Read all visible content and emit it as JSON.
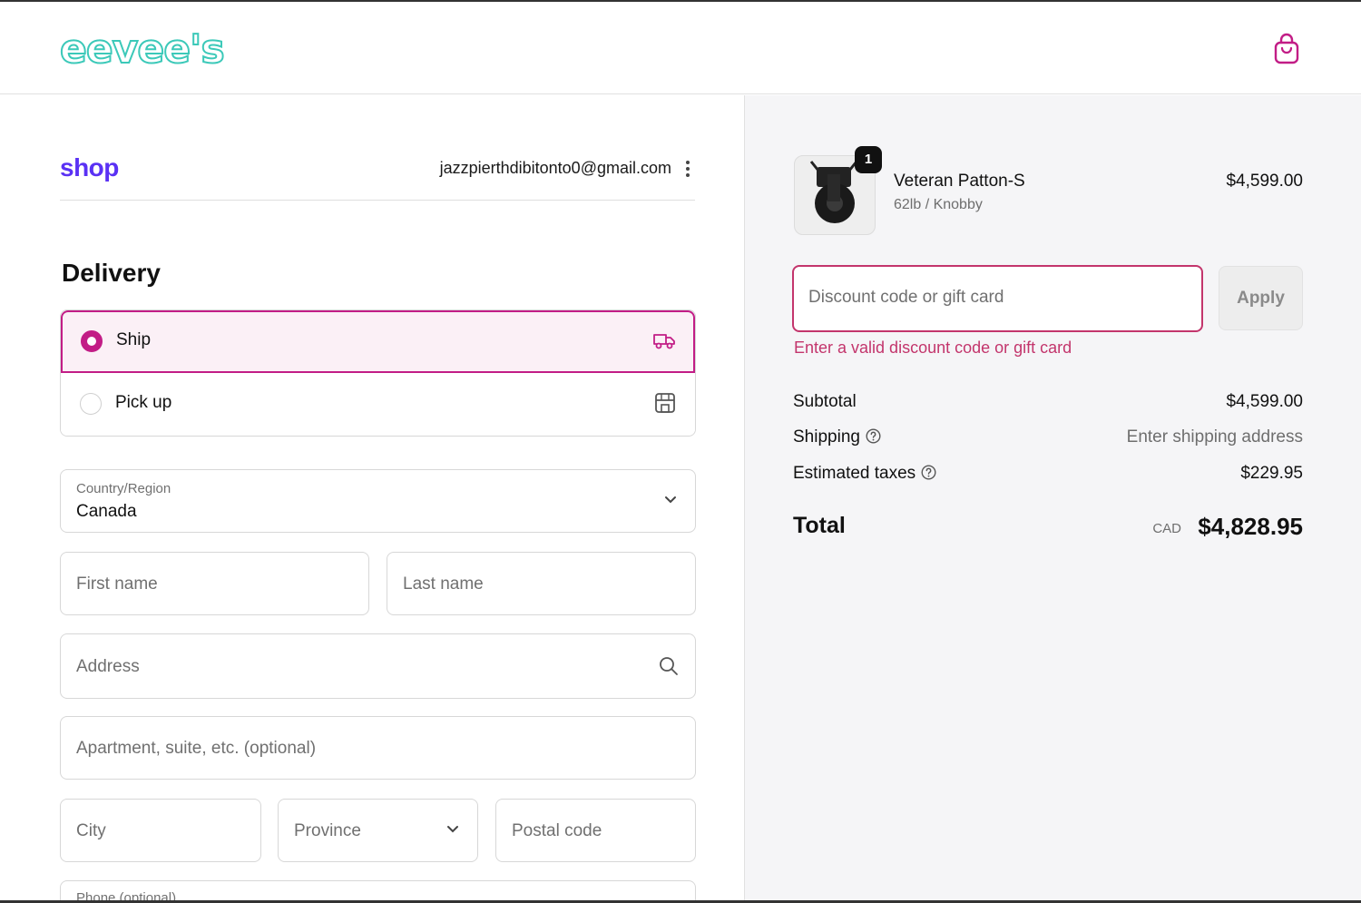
{
  "header": {
    "logo_text": "eevee's",
    "cart_icon": "shopping-bag-icon",
    "accent_color": "#c21d86",
    "logo_color": "#3cc9b9"
  },
  "account": {
    "shop_logo": "shop",
    "email": "jazzpierthdibitonto0@gmail.com",
    "menu_icon": "kebab-menu-icon"
  },
  "delivery": {
    "heading": "Delivery",
    "options": [
      {
        "label": "Ship",
        "selected": true,
        "icon": "truck-icon"
      },
      {
        "label": "Pick up",
        "selected": false,
        "icon": "store-icon"
      }
    ]
  },
  "form": {
    "country_label": "Country/Region",
    "country_value": "Canada",
    "first_name_placeholder": "First name",
    "last_name_placeholder": "Last name",
    "address_placeholder": "Address",
    "apartment_placeholder": "Apartment, suite, etc. (optional)",
    "city_placeholder": "City",
    "province_placeholder": "Province",
    "postal_placeholder": "Postal code",
    "phone_placeholder": "Phone (optional)"
  },
  "order": {
    "item": {
      "quantity": "1",
      "name": "Veteran Patton-S",
      "variant": "62lb / Knobby",
      "price": "$4,599.00"
    },
    "discount": {
      "placeholder": "Discount code or gift card",
      "apply_label": "Apply",
      "error": "Enter a valid discount code or gift card",
      "error_color": "#c3356c"
    },
    "summary": {
      "subtotal_label": "Subtotal",
      "subtotal_value": "$4,599.00",
      "shipping_label": "Shipping",
      "shipping_value": "Enter shipping address",
      "taxes_label": "Estimated taxes",
      "taxes_value": "$229.95",
      "total_label": "Total",
      "currency": "CAD",
      "total_value": "$4,828.95"
    }
  }
}
